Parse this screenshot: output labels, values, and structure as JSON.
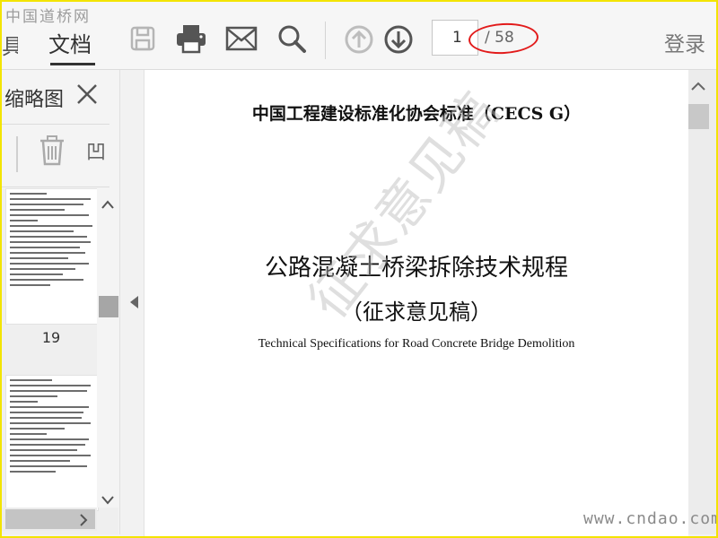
{
  "watermark_logo": "中国道桥网",
  "toolbar": {
    "tab_tools": "具",
    "tab_document": "文档",
    "page_current": "1",
    "page_total": "/ 58",
    "login_label": "登录",
    "icons": [
      "save-icon",
      "print-icon",
      "mail-icon",
      "search-icon",
      "arrow-up-icon",
      "arrow-down-icon"
    ]
  },
  "sidebar": {
    "title": "缩略图",
    "more_label": "凹",
    "thumbnail_label": "19"
  },
  "document": {
    "standard_line": "中国工程建设标准化协会标准（CECS G）",
    "title_cn": "公路混凝土桥梁拆除技术规程",
    "subtitle": "（征求意见稿）",
    "title_en": "Technical Specifications for Road Concrete Bridge Demolition",
    "stamp_text": "征求意见稿"
  },
  "site_watermark": "www.cndao.com",
  "colors": {
    "frame": "#f3e400",
    "annotation": "#e21b1b",
    "toolbar_bg": "#f6f6f6"
  }
}
